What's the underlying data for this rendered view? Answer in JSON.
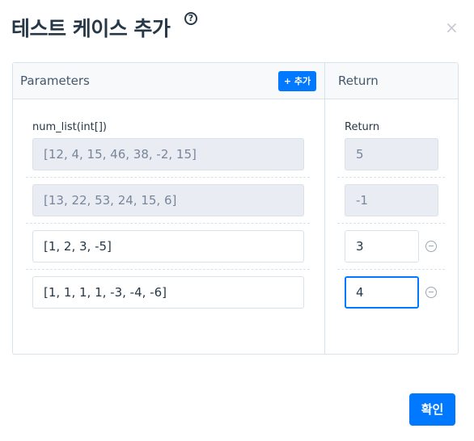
{
  "dialog": {
    "title": "테스트 케이스 추가",
    "help_symbol": "?",
    "close_symbol": "×",
    "confirm_label": "확인"
  },
  "table": {
    "params_header": "Parameters",
    "add_label": "+ 추가",
    "return_header": "Return",
    "param_name": "num_list(int[])",
    "return_label": "Return",
    "rows": [
      {
        "param": "[12, 4, 15, 46, 38, -2, 15]",
        "return": "5",
        "editable": false
      },
      {
        "param": "[13, 22, 53, 24, 15, 6]",
        "return": "-1",
        "editable": false
      },
      {
        "param": "[1, 2, 3, -5]",
        "return": "3",
        "editable": true
      },
      {
        "param": "[1, 1, 1, 1, -3, -4, -6]",
        "return": "4",
        "editable": true
      }
    ]
  }
}
